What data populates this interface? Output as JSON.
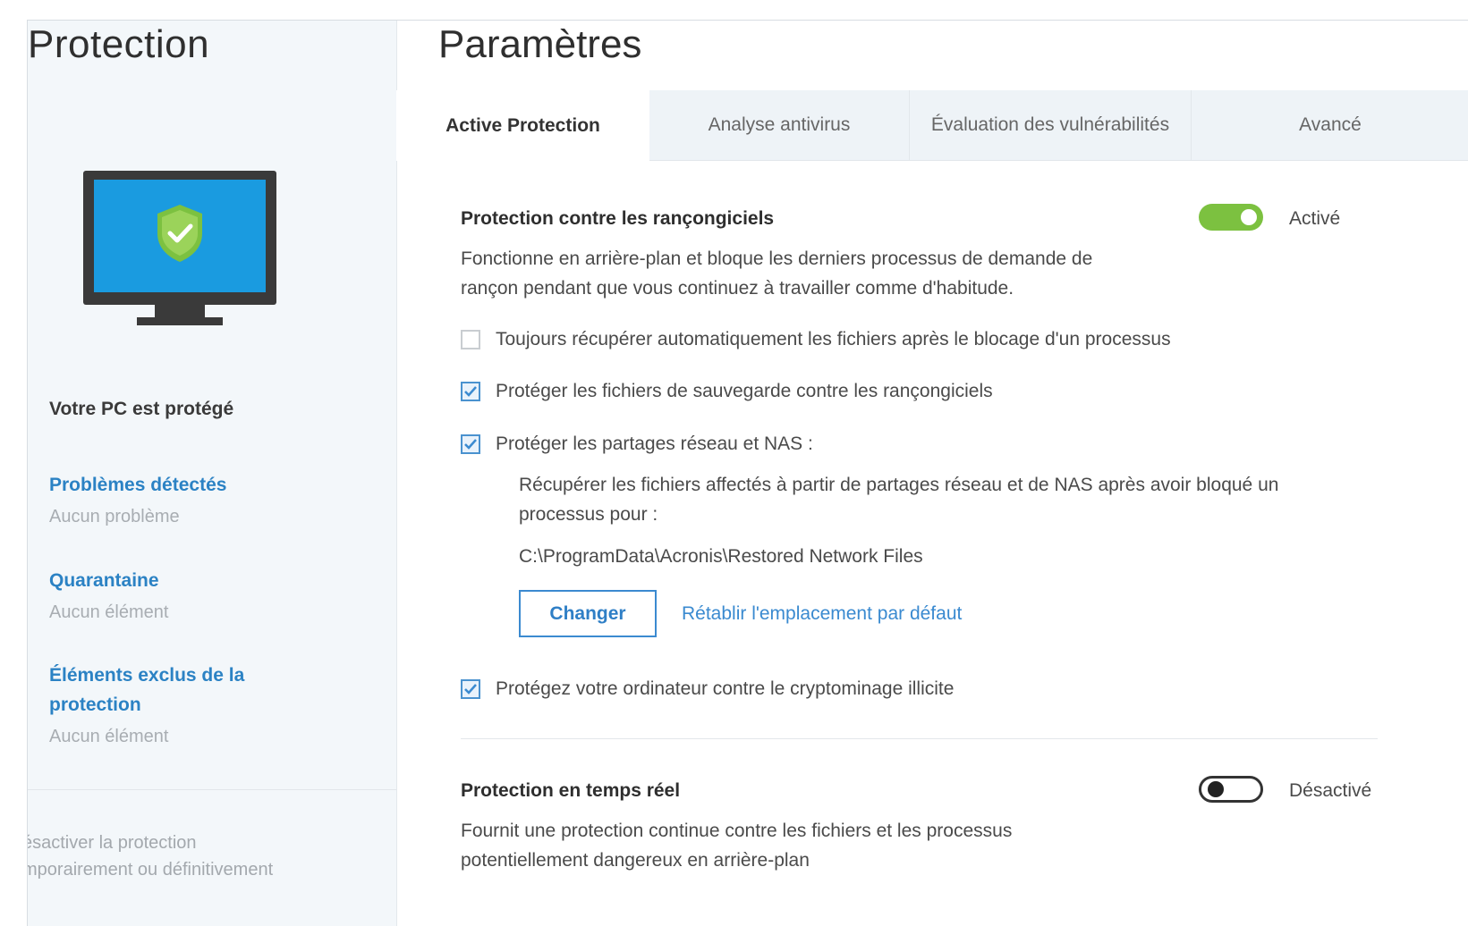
{
  "sidebar": {
    "title": "Protection",
    "status": "Votre PC est protégé",
    "links": [
      {
        "title": "Problèmes détectés",
        "subtitle": "Aucun problème"
      },
      {
        "title": "Quarantaine",
        "subtitle": "Aucun élément"
      },
      {
        "title": "Éléments exclus de la protection",
        "subtitle": "Aucun élément"
      }
    ],
    "footer": "ésactiver la protection\nmporairement ou définitivement"
  },
  "main": {
    "title": "Paramètres",
    "tabs": [
      {
        "label": "Active Protection",
        "active": true
      },
      {
        "label": "Analyse antivirus",
        "active": false
      },
      {
        "label": "Évaluation des vulnérabilités",
        "active": false
      },
      {
        "label": "Avancé",
        "active": false
      }
    ]
  },
  "ransomware": {
    "title": "Protection contre les rançongiciels",
    "toggle_state": "on",
    "toggle_label": "Activé",
    "description": "Fonctionne en arrière-plan et bloque les derniers processus de demande de\nrançon pendant que vous continuez à travailler comme d'habitude.",
    "options": [
      {
        "label": "Toujours récupérer automatiquement les fichiers après le blocage d'un processus",
        "checked": false
      },
      {
        "label": "Protéger les fichiers de sauvegarde contre les rançongiciels",
        "checked": true
      },
      {
        "label": "Protéger les partages réseau et NAS :",
        "checked": true
      }
    ],
    "recover_text": "Récupérer les fichiers affectés à partir de partages réseau et de NAS après avoir bloqué un\nprocessus pour :",
    "path": "C:\\ProgramData\\Acronis\\Restored Network Files",
    "change_button": "Changer",
    "reset_link": "Rétablir l'emplacement par défaut",
    "crypto_option": {
      "label": "Protégez votre ordinateur contre le cryptominage illicite",
      "checked": true
    }
  },
  "realtime": {
    "title": "Protection en temps réel",
    "toggle_state": "off",
    "toggle_label": "Désactivé",
    "description": "Fournit une protection continue contre les fichiers et les processus\npotentiellement dangereux en arrière-plan"
  },
  "colors": {
    "accent": "#2b82c4",
    "toggle_on": "#7cc140",
    "monitor_screen": "#1a9be0",
    "shield": "#7cc140"
  }
}
